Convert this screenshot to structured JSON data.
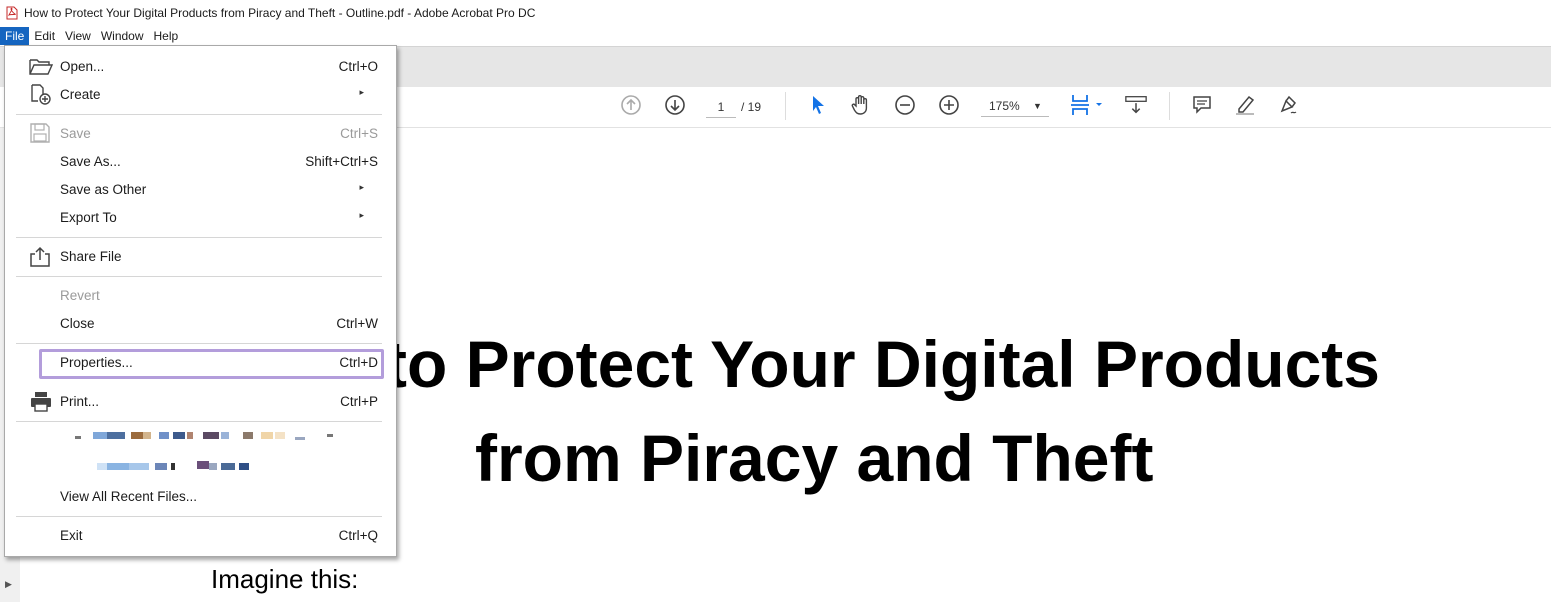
{
  "window": {
    "title": "How to Protect Your Digital Products from Piracy and Theft - Outline.pdf - Adobe Acrobat Pro DC"
  },
  "menubar": {
    "items": [
      "File",
      "Edit",
      "View",
      "Window",
      "Help"
    ],
    "active": "File"
  },
  "toolbar": {
    "page_current": "1",
    "page_total": "/ 19",
    "zoom": "175%"
  },
  "file_menu": {
    "open": {
      "label": "Open...",
      "shortcut": "Ctrl+O"
    },
    "create": {
      "label": "Create"
    },
    "save": {
      "label": "Save",
      "shortcut": "Ctrl+S"
    },
    "save_as": {
      "label": "Save As...",
      "shortcut": "Shift+Ctrl+S"
    },
    "save_as_other": {
      "label": "Save as Other"
    },
    "export_to": {
      "label": "Export To"
    },
    "share_file": {
      "label": "Share File"
    },
    "revert": {
      "label": "Revert"
    },
    "close": {
      "label": "Close",
      "shortcut": "Ctrl+W"
    },
    "properties": {
      "label": "Properties...",
      "shortcut": "Ctrl+D"
    },
    "print": {
      "label": "Print...",
      "shortcut": "Ctrl+P"
    },
    "view_all_recent": {
      "label": "View All Recent Files..."
    },
    "exit": {
      "label": "Exit",
      "shortcut": "Ctrl+Q"
    }
  },
  "document": {
    "title_line1": "to Protect Your Digital Products",
    "title_line2": "from Piracy and Theft",
    "body_line1": "Imagine this:"
  },
  "colors": {
    "accent": "#1565c0",
    "highlight": "#b39ddb",
    "toolbar_icon": "#555555",
    "select_icon": "#1473e6"
  }
}
